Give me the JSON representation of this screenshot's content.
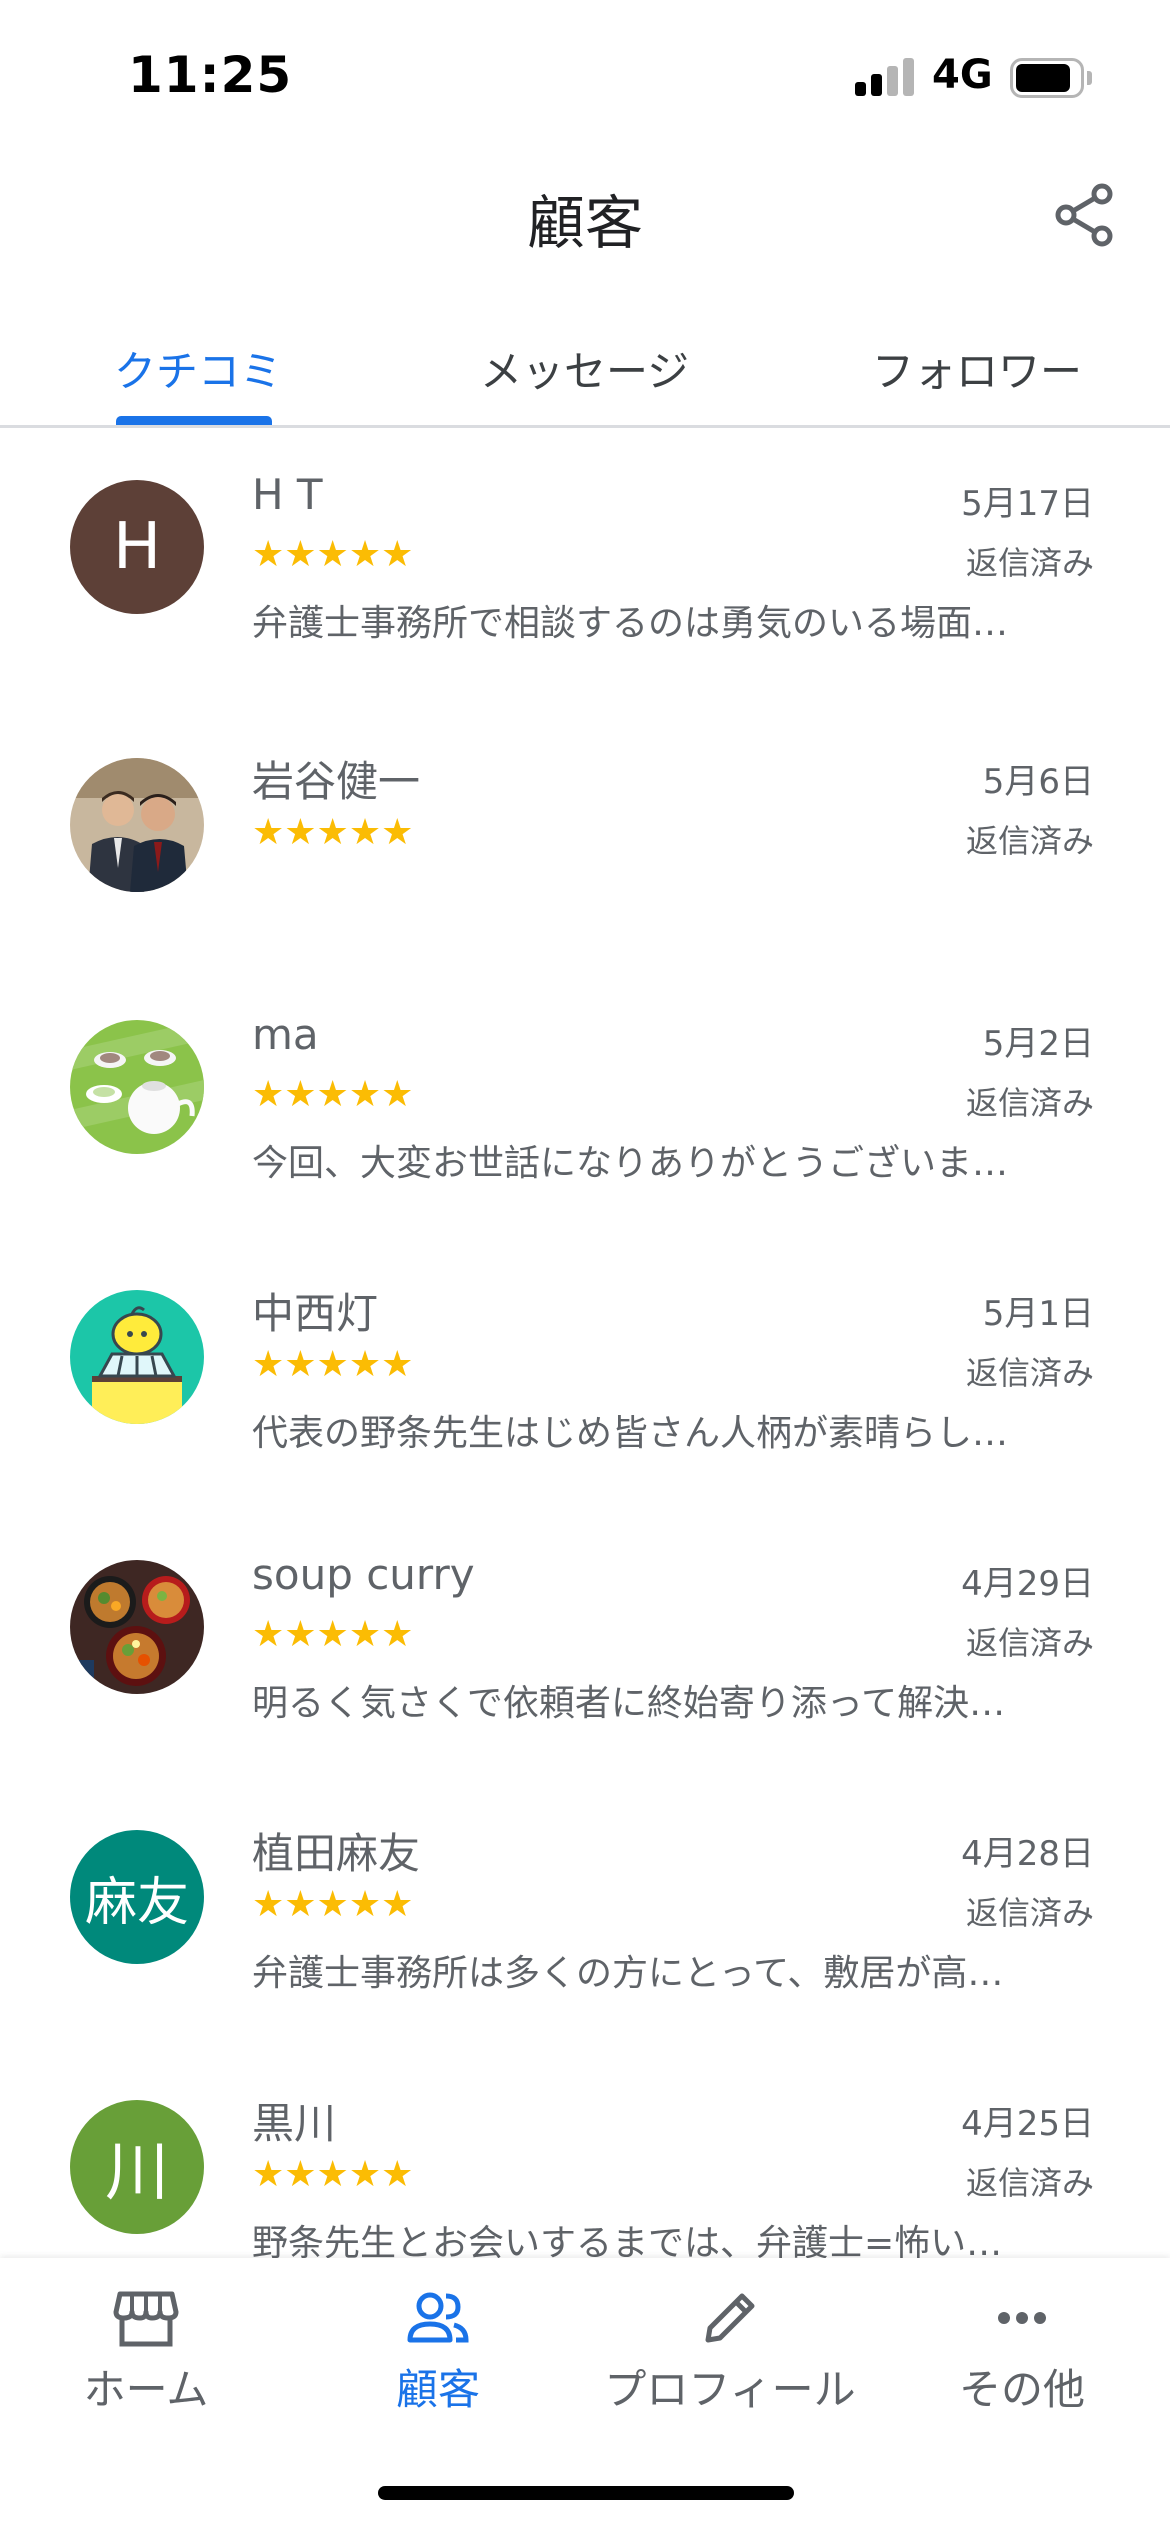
{
  "status_bar": {
    "time": "11:25",
    "network": "4G"
  },
  "header": {
    "title": "顧客"
  },
  "tabs": [
    {
      "label": "クチコミ",
      "active": true
    },
    {
      "label": "メッセージ",
      "active": false
    },
    {
      "label": "フォロワー",
      "active": false
    }
  ],
  "reviews": [
    {
      "name": "H T",
      "avatar_letter": "H",
      "avatar_color": "#5d4037",
      "rating": 5,
      "stars": "★★★★★",
      "date": "5月17日",
      "status": "返信済み",
      "text": "弁護士事務所で相談するのは勇気のいる場面…"
    },
    {
      "name": "岩谷健一",
      "avatar_letter": "",
      "avatar_color": "#8d6e63",
      "rating": 5,
      "stars": "★★★★★",
      "date": "5月6日",
      "status": "返信済み",
      "text": ""
    },
    {
      "name": "ma",
      "avatar_letter": "",
      "avatar_color": "#8bc34a",
      "rating": 5,
      "stars": "★★★★★",
      "date": "5月2日",
      "status": "返信済み",
      "text": "今回、大変お世話になりありがとうございま…"
    },
    {
      "name": "中西灯",
      "avatar_letter": "",
      "avatar_color": "#1cc6a8",
      "rating": 5,
      "stars": "★★★★★",
      "date": "5月1日",
      "status": "返信済み",
      "text": "代表の野条先生はじめ皆さん人柄が素晴らし…"
    },
    {
      "name": "soup curry",
      "avatar_letter": "",
      "avatar_color": "#6d4c41",
      "rating": 5,
      "stars": "★★★★★",
      "date": "4月29日",
      "status": "返信済み",
      "text": "明るく気さくで依頼者に終始寄り添って解決…"
    },
    {
      "name": "植田麻友",
      "avatar_letter": "麻友",
      "avatar_color": "#00897b",
      "rating": 5,
      "stars": "★★★★★",
      "date": "4月28日",
      "status": "返信済み",
      "text": "弁護士事務所は多くの方にとって、敷居が高…"
    },
    {
      "name": "黒川",
      "avatar_letter": "川",
      "avatar_color": "#689f38",
      "rating": 5,
      "stars": "★★★★★",
      "date": "4月25日",
      "status": "返信済み",
      "text": "野条先生とお会いするまでは、弁護士=怖い…"
    }
  ],
  "bottom_nav": [
    {
      "label": "ホーム",
      "icon": "storefront-icon",
      "active": false
    },
    {
      "label": "顧客",
      "icon": "people-icon",
      "active": true
    },
    {
      "label": "プロフィール",
      "icon": "pencil-icon",
      "active": false
    },
    {
      "label": "その他",
      "icon": "more-horiz-icon",
      "active": false
    }
  ],
  "colors": {
    "accent": "#1a73e8",
    "star": "#fbbc04"
  }
}
